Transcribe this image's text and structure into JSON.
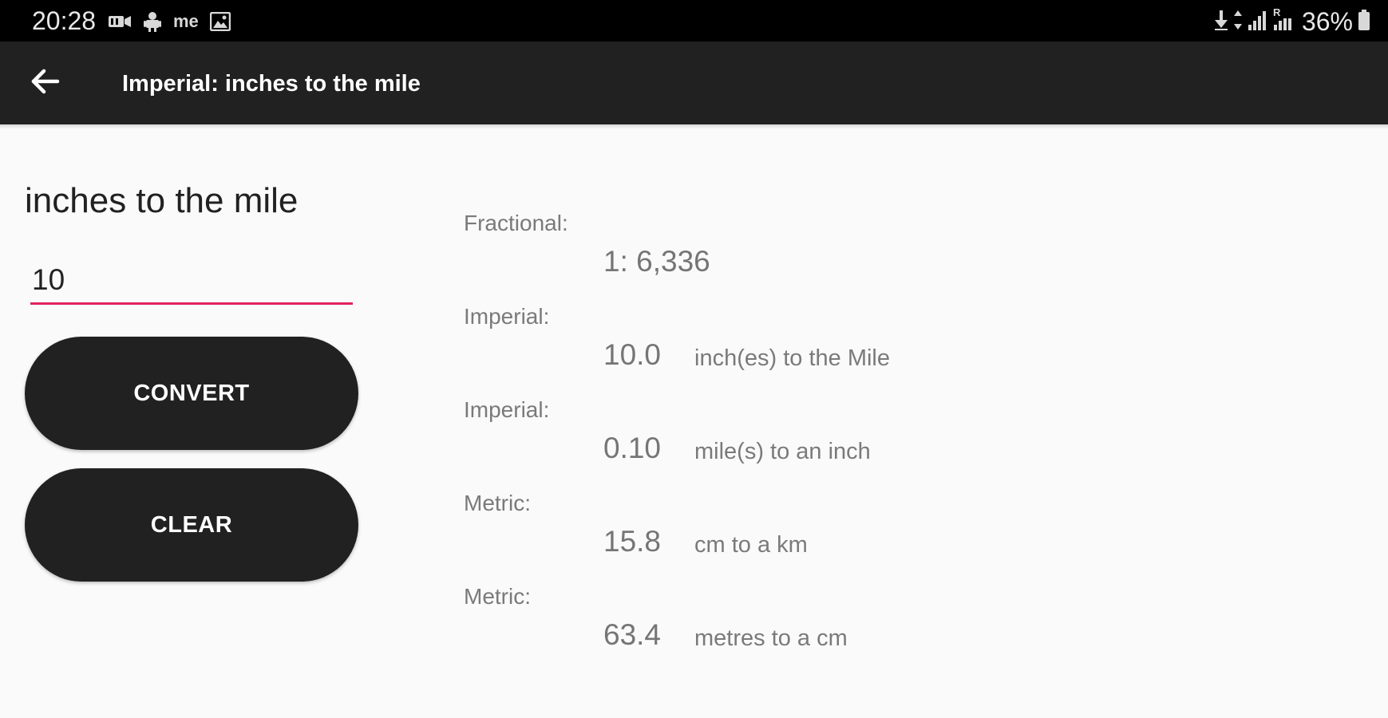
{
  "status_bar": {
    "time": "20:28",
    "left_icons": [
      "video-icon",
      "android-icon",
      "me-icon",
      "gallery-icon"
    ],
    "me_text": "me",
    "right_icons": [
      "download-icon",
      "data-arrows-icon",
      "signal-icon",
      "signal-r-icon",
      "battery-icon"
    ],
    "signal_r": "R",
    "battery": "36%"
  },
  "app_bar": {
    "title": "Imperial: inches to the mile",
    "back_icon": "arrow-left-icon"
  },
  "form": {
    "heading": "inches to the mile",
    "input_value": "10",
    "input_color": "#e0245e",
    "convert_label": "CONVERT",
    "clear_label": "CLEAR",
    "button_color": "#212121"
  },
  "results": {
    "fractional": {
      "label": "Fractional:",
      "value": "1: 6,336"
    },
    "imperial_inches": {
      "label": "Imperial:",
      "value": "10.0",
      "unit": "inch(es) to the Mile"
    },
    "imperial_miles": {
      "label": "Imperial:",
      "value": "0.10",
      "unit": "mile(s) to an inch"
    },
    "metric_cm": {
      "label": "Metric:",
      "value": "15.8",
      "unit": "cm to a km"
    },
    "metric_metres": {
      "label": "Metric:",
      "value": "63.4",
      "unit": "metres to a cm"
    }
  }
}
